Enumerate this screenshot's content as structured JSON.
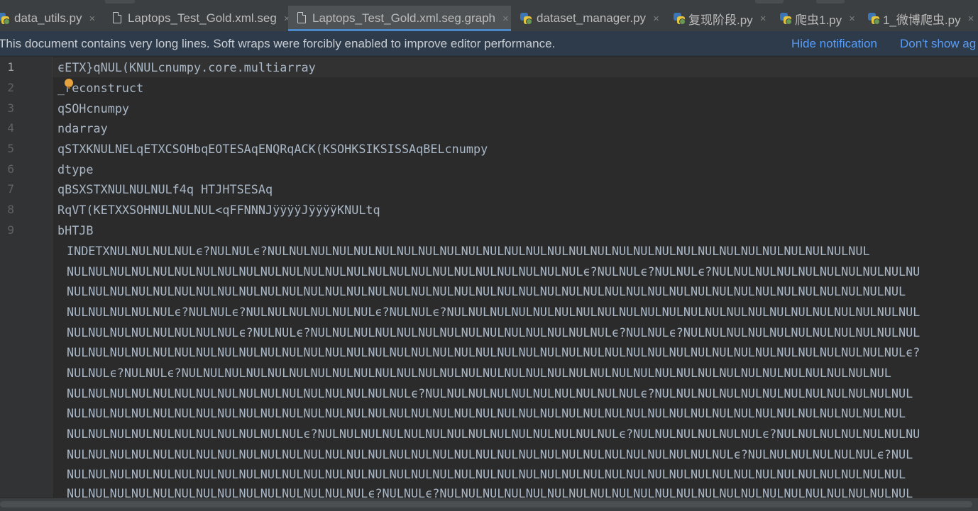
{
  "tabs": [
    {
      "label": "data_utils.py",
      "icon": "python-file-icon",
      "active": false
    },
    {
      "label": "Laptops_Test_Gold.xml.seg",
      "icon": "text-file-icon",
      "active": false
    },
    {
      "label": "Laptops_Test_Gold.xml.seg.graph",
      "icon": "text-file-icon",
      "active": true
    },
    {
      "label": "dataset_manager.py",
      "icon": "python-file-icon",
      "active": false
    },
    {
      "label": "复现阶段.py",
      "icon": "python-file-icon",
      "active": false
    },
    {
      "label": "爬虫1.py",
      "icon": "python-file-icon",
      "active": false
    },
    {
      "label": "1_微博爬虫.py",
      "icon": "python-file-icon",
      "active": false
    }
  ],
  "tab_close_glyph": "×",
  "notification": {
    "message": "This document contains very long lines. Soft wraps were forcibly enabled to improve editor performance.",
    "hide_link": "Hide notification",
    "dont_show_link": "Don't show ag"
  },
  "line_numbers": [
    "1",
    "2",
    "3",
    "4",
    "5",
    "6",
    "7",
    "8",
    "9"
  ],
  "code_lines": [
    "ϵETX}qNUL(KNULcnumpy.core.multiarray",
    "_reconstruct",
    "qSOHcnumpy",
    "ndarray",
    "qSTXKNULNELqETXCSOHbqEOTESAqENQRqACK(KSOHKSIKSISSAqBELcnumpy",
    "dtype",
    "qBSXSTXNULNULNULf4q HTJHTSESAq",
    "RqVT(KETXXSOHNULNULNUL<qFFNNNJÿÿÿÿJÿÿÿÿKNULtq",
    "bHTJB"
  ],
  "wrapped_lines": [
    "INDETXNULNULNULNULϵ?NULNULϵ?NULNULNULNULNULNULNULNULNULNULNULNULNULNULNULNULNULNULNULNULNULNULNULNULNULNULNULNUL",
    "NULNULNULNULNULNULNULNULNULNULNULNULNULNULNULNULNULNULNULNULNULNULNULNULϵ?NULNULϵ?NULNULϵ?NULNULNULNULNULNULNULNULNULNU",
    "NULNULNULNULNULNULNULNULNULNULNULNULNULNULNULNULNULNULNULNULNULNULNULNULNULNULNULNULNULNULNULNULNULNULNULNULNULNULNUL",
    "NULNULNULNULNULϵ?NULNULϵ?NULNULNULNULNULNULϵ?NULNULϵ?NULNULNULNULNULNULNULNULNULNULNULNULNULNULNULNULNULNULNULNULNULNUL",
    "NULNULNULNULNULNULNULNULϵ?NULNULϵ?NULNULNULNULNULNULNULNULNULNULNULNULNULNULϵ?NULNULϵ?NULNULNULNULNULNULNULNULNULNULNUL",
    "NULNULNULNULNULNULNULNULNULNULNULNULNULNULNULNULNULNULNULNULNULNULNULNULNULNULNULNULNULNULNULNULNULNULNULNULNULNULNULϵ?",
    "NULNULϵ?NULNULϵ?NULNULNULNULNULNULNULNULNULNULNULNULNULNULNULNULNULNULNULNULNULNULNULNULNULNULNULNULNULNULNULNULNUL",
    "NULNULNULNULNULNULNULNULNULNULNULNULNULNULNULNULϵ?NULNULNULNULNULNULNULNULNULNULϵ?NULNULNULNULNULNULNULNULNULNULNULNUL",
    "NULNULNULNULNULNULNULNULNULNULNULNULNULNULNULNULNULNULNULNULNULNULNULNULNULNULNULNULNULNULNULNULNULNULNULNULNULNULNUL",
    "NULNULNULNULNULNULNULNULNULNULNULϵ?NULNULNULNULNULNULNULNULNULNULNULNULNULNULϵ?NULNULNULNULNULNULϵ?NULNULNULNULNULNULNU",
    "NULNULNULNULNULNULNULNULNULNULNULNULNULNULNULNULNULNULNULNULNULNULNULNULNULNULNULNULNULNULNULϵ?NULNULNULNULNULNULϵ?NUL",
    "NULNULNULNULNULNULNULNULNULNULNULNULNULNULNULNULNULNULNULNULNULNULNULNULNULNULNULNULNULNULNULNULNULNULNULNULNULNULNUL",
    "NULNULNULNULNULNULNULNULNULNULNULNULNULNULϵ?NULNULϵ?NULNULNULNULNULNULNULNULNULNULNULNULNULNULNULNULNULNULNULNULNULNUL"
  ]
}
